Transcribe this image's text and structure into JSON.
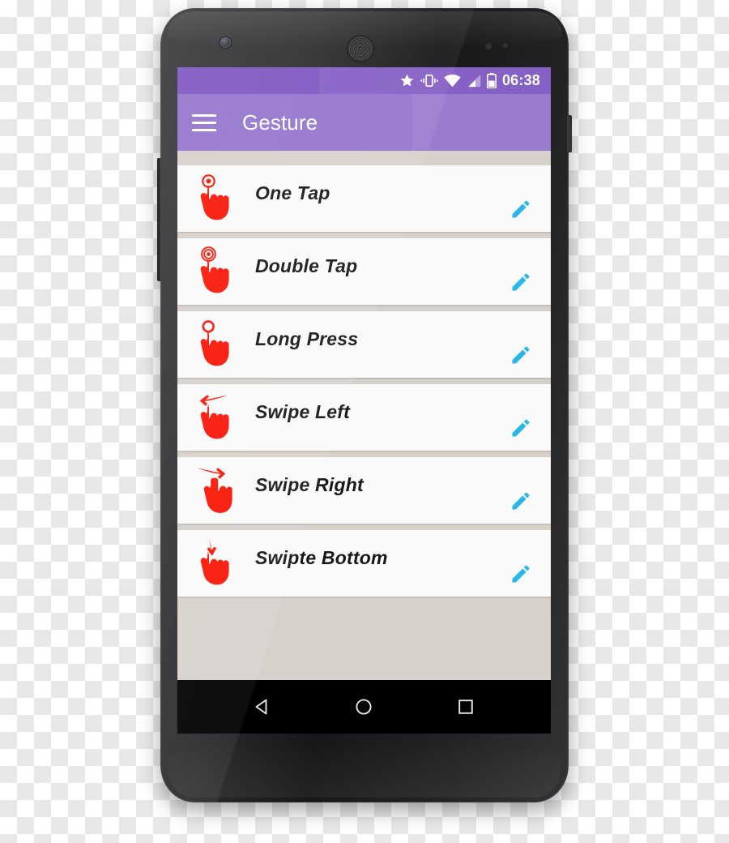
{
  "device": {
    "name": "android-phone-mockup",
    "front_camera": "camera-icon",
    "earpiece": "speaker-grille-icon",
    "power_button": "power-button",
    "volume_button": "volume-rocker-button"
  },
  "status_bar": {
    "background_color": "#7E57C2",
    "clock": "06:38",
    "icons": [
      {
        "name": "star-icon",
        "label": "star"
      },
      {
        "name": "vibrate-icon",
        "label": "vibrate mode"
      },
      {
        "name": "wifi-icon",
        "label": "wifi"
      },
      {
        "name": "signal-icon",
        "label": "cellular signal"
      },
      {
        "name": "battery-icon",
        "label": "battery"
      }
    ]
  },
  "toolbar": {
    "background_color": "#9575CD",
    "menu_icon": "hamburger-menu-icon",
    "title": "Gesture"
  },
  "list": {
    "background_color": "#D7D1CC",
    "card_color": "#FAFAFA",
    "icon_color": "#FA1505",
    "edit_icon_color": "#29B6E8",
    "edit_icon_name": "pencil-edit-icon",
    "items": [
      {
        "label": "One Tap",
        "icon": "hand-one-tap-icon"
      },
      {
        "label": "Double Tap",
        "icon": "hand-double-tap-icon"
      },
      {
        "label": "Long Press",
        "icon": "hand-long-press-icon"
      },
      {
        "label": "Swipe Left",
        "icon": "hand-swipe-left-icon"
      },
      {
        "label": "Swipe Right",
        "icon": "hand-swipe-right-icon"
      },
      {
        "label": "Swipte Bottom",
        "icon": "hand-swipe-bottom-icon"
      }
    ]
  },
  "nav_bar": {
    "background_color": "#000000",
    "buttons": [
      {
        "name": "nav-back-button",
        "label": "Back"
      },
      {
        "name": "nav-home-button",
        "label": "Home"
      },
      {
        "name": "nav-recents-button",
        "label": "Recents"
      }
    ]
  }
}
